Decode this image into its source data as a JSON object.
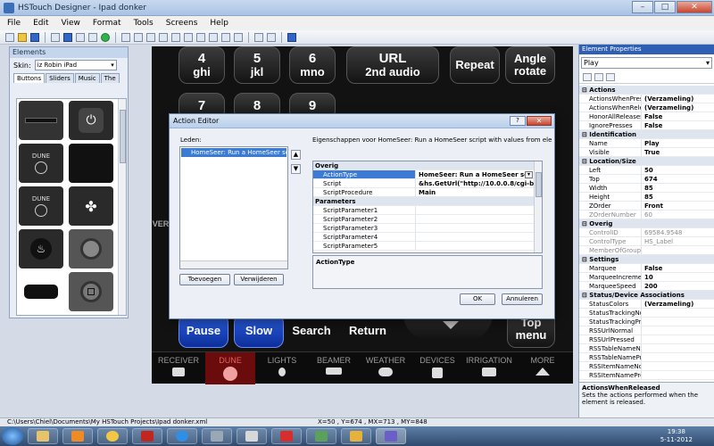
{
  "window": {
    "title": "HSTouch Designer - Ipad donker",
    "min": "–",
    "max": "□",
    "close": "✕"
  },
  "menu": [
    "File",
    "Edit",
    "View",
    "Format",
    "Tools",
    "Screens",
    "Help"
  ],
  "elements_panel": {
    "title": "Elements",
    "skin_label": "Skin:",
    "skin_value": "iz Robin iPad",
    "tabs": [
      "Buttons",
      "Sliders",
      "Music",
      "The"
    ],
    "items": [
      "",
      "",
      "DUNE",
      "",
      "DUNE",
      "",
      "",
      "",
      "",
      ""
    ]
  },
  "canvas": {
    "buttons": {
      "b4": [
        "4",
        "ghi"
      ],
      "b5": [
        "5",
        "jkl"
      ],
      "b6": [
        "6",
        "mno"
      ],
      "url": [
        "URL",
        "2nd audio"
      ],
      "repeat": "Repeat",
      "angle": [
        "Angle",
        "rotate"
      ],
      "b7": "7",
      "b8": "8",
      "b9": "9",
      "pause": "Pause",
      "slow": "Slow",
      "search": "Search",
      "return": "Return",
      "topmenu": [
        "Top",
        "menu"
      ]
    },
    "side_text": "VER",
    "nav": [
      "RECEIVER",
      "DUNE",
      "LIGHTS",
      "BEAMER",
      "WEATHER",
      "DEVICES",
      "IRRIGATION",
      "MORE"
    ]
  },
  "dialog": {
    "title": "Action Editor",
    "help_btn": "?",
    "close_btn": "✕",
    "leden_label": "Leden:",
    "leden_item": "HomeSeer: Run a HomeSeer scri",
    "props_label": "Eigenschappen voor HomeSeer: Run a HomeSeer script with values from elements(s):",
    "toevoegen": "Toevoegen",
    "verwijderen": "Verwijderen",
    "ok": "OK",
    "annuleren": "Annuleren",
    "desc": "ActionType",
    "grid": [
      {
        "type": "cat",
        "k": "Overig"
      },
      {
        "type": "hl",
        "k": "ActionType",
        "v": "HomeSeer: Run a HomeSeer sc"
      },
      {
        "k": "Script",
        "v": "&hs.GetUrl(\"http://10.0.0.8/cgi-bi"
      },
      {
        "k": "ScriptProcedure",
        "v": "Main"
      },
      {
        "type": "cat",
        "k": "Parameters"
      },
      {
        "k": "ScriptParameter1",
        "v": ""
      },
      {
        "k": "ScriptParameter2",
        "v": ""
      },
      {
        "k": "ScriptParameter3",
        "v": ""
      },
      {
        "k": "ScriptParameter4",
        "v": ""
      },
      {
        "k": "ScriptParameter5",
        "v": ""
      }
    ]
  },
  "props": {
    "title": "Element Properties",
    "selected": "Play",
    "rows": [
      {
        "type": "cat",
        "k": "Actions"
      },
      {
        "k": "ActionsWhenPresse",
        "v": "(Verzameling)"
      },
      {
        "k": "ActionsWhenRelease",
        "v": "(Verzameling)"
      },
      {
        "k": "HonorAllReleases",
        "v": "False"
      },
      {
        "k": "IgnorePresses",
        "v": "False"
      },
      {
        "type": "cat",
        "k": "Identification"
      },
      {
        "k": "Name",
        "v": "Play"
      },
      {
        "k": "Visible",
        "v": "True"
      },
      {
        "type": "cat",
        "k": "Location/Size"
      },
      {
        "k": "Left",
        "v": "50"
      },
      {
        "k": "Top",
        "v": "674"
      },
      {
        "k": "Width",
        "v": "85"
      },
      {
        "k": "Height",
        "v": "85"
      },
      {
        "k": "ZOrder",
        "v": "Front"
      },
      {
        "type": "dim",
        "k": "ZOrderNumber",
        "v": "60"
      },
      {
        "type": "cat",
        "k": "Overig"
      },
      {
        "type": "dim",
        "k": "ControlID",
        "v": "69584.9548"
      },
      {
        "type": "dim",
        "k": "ControlType",
        "v": "HS_Label"
      },
      {
        "type": "dim",
        "k": "MemberOfGroup",
        "v": ""
      },
      {
        "type": "cat",
        "k": "Settings"
      },
      {
        "k": "Marquee",
        "v": "False"
      },
      {
        "k": "MarqueeIncrement",
        "v": "10"
      },
      {
        "k": "MarqueeSpeed",
        "v": "200"
      },
      {
        "type": "cat",
        "k": "Status/Device Associations"
      },
      {
        "k": "StatusColors",
        "v": "(Verzameling)"
      },
      {
        "k": "StatusTrackingNorm",
        "v": ""
      },
      {
        "k": "StatusTrackingPress",
        "v": ""
      },
      {
        "k": "RSSUrlNormal",
        "v": ""
      },
      {
        "k": "RSSUrlPressed",
        "v": ""
      },
      {
        "k": "RSSTableNameNorm",
        "v": ""
      },
      {
        "k": "RSSTableNamePres",
        "v": ""
      },
      {
        "k": "RSSItemNameNorm",
        "v": ""
      },
      {
        "k": "RSSItemNamePres",
        "v": ""
      }
    ],
    "help_title": "ActionsWhenReleased",
    "help_text": "Sets the actions performed when the element is released."
  },
  "status": {
    "path": "C:\\Users\\Chiel\\Documents\\My HSTouch Projects\\Ipad donker.xml",
    "coords": "X=50 , Y=674 , MX=713 , MY=848"
  },
  "clock": {
    "time": "19:38",
    "date": "5-11-2012"
  }
}
